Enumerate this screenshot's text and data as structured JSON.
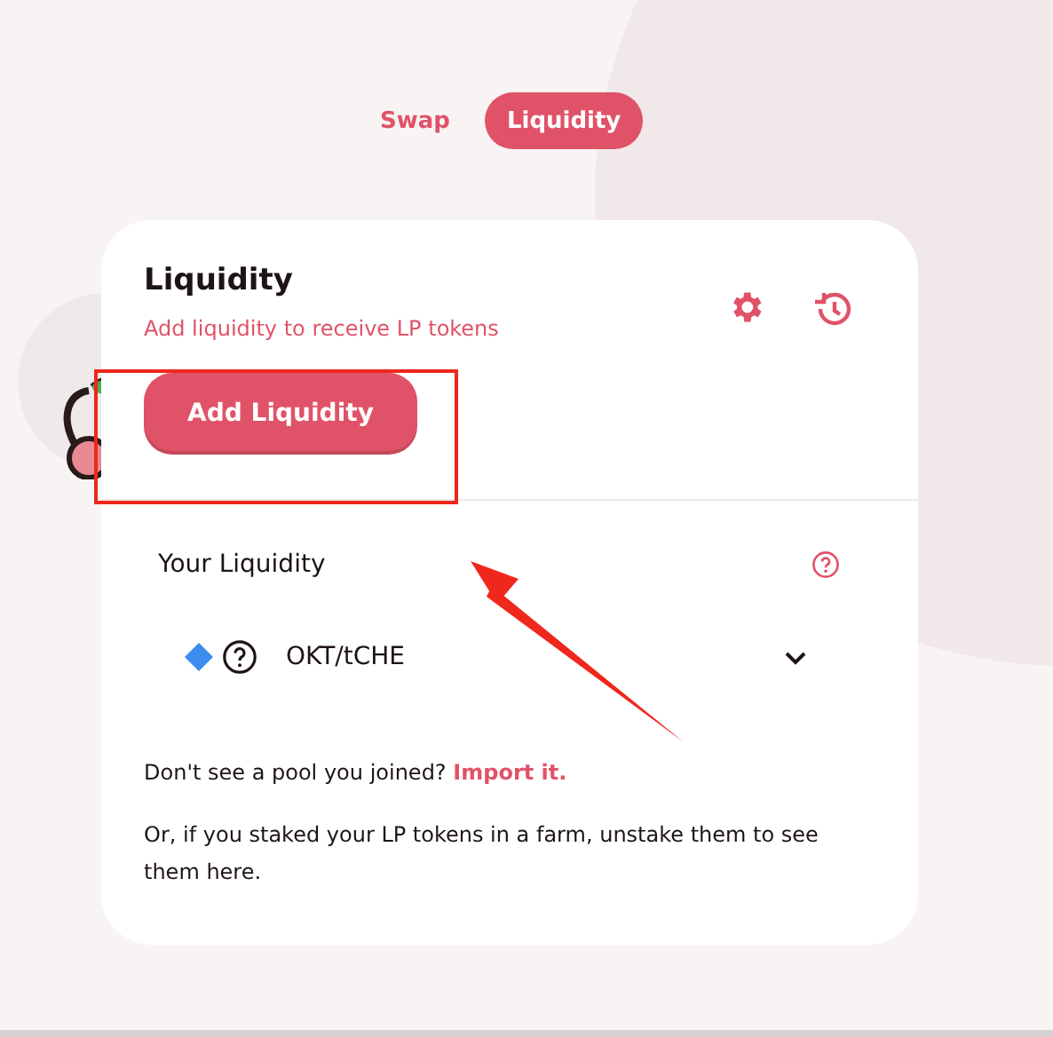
{
  "tabs": [
    {
      "label": "Swap",
      "selected": false
    },
    {
      "label": "Liquidity",
      "selected": true
    }
  ],
  "card": {
    "title": "Liquidity",
    "subtitle": "Add liquidity to receive LP tokens",
    "add_button": "Add Liquidity"
  },
  "your_liquidity": {
    "heading": "Your Liquidity",
    "pools": [
      {
        "name": "OKT/tCHE",
        "expanded": false
      }
    ]
  },
  "import_prompt": {
    "text": "Don't see a pool you joined?",
    "link": "Import it."
  },
  "note": "Or, if you staked your LP tokens in a farm, unstake them to see them here."
}
